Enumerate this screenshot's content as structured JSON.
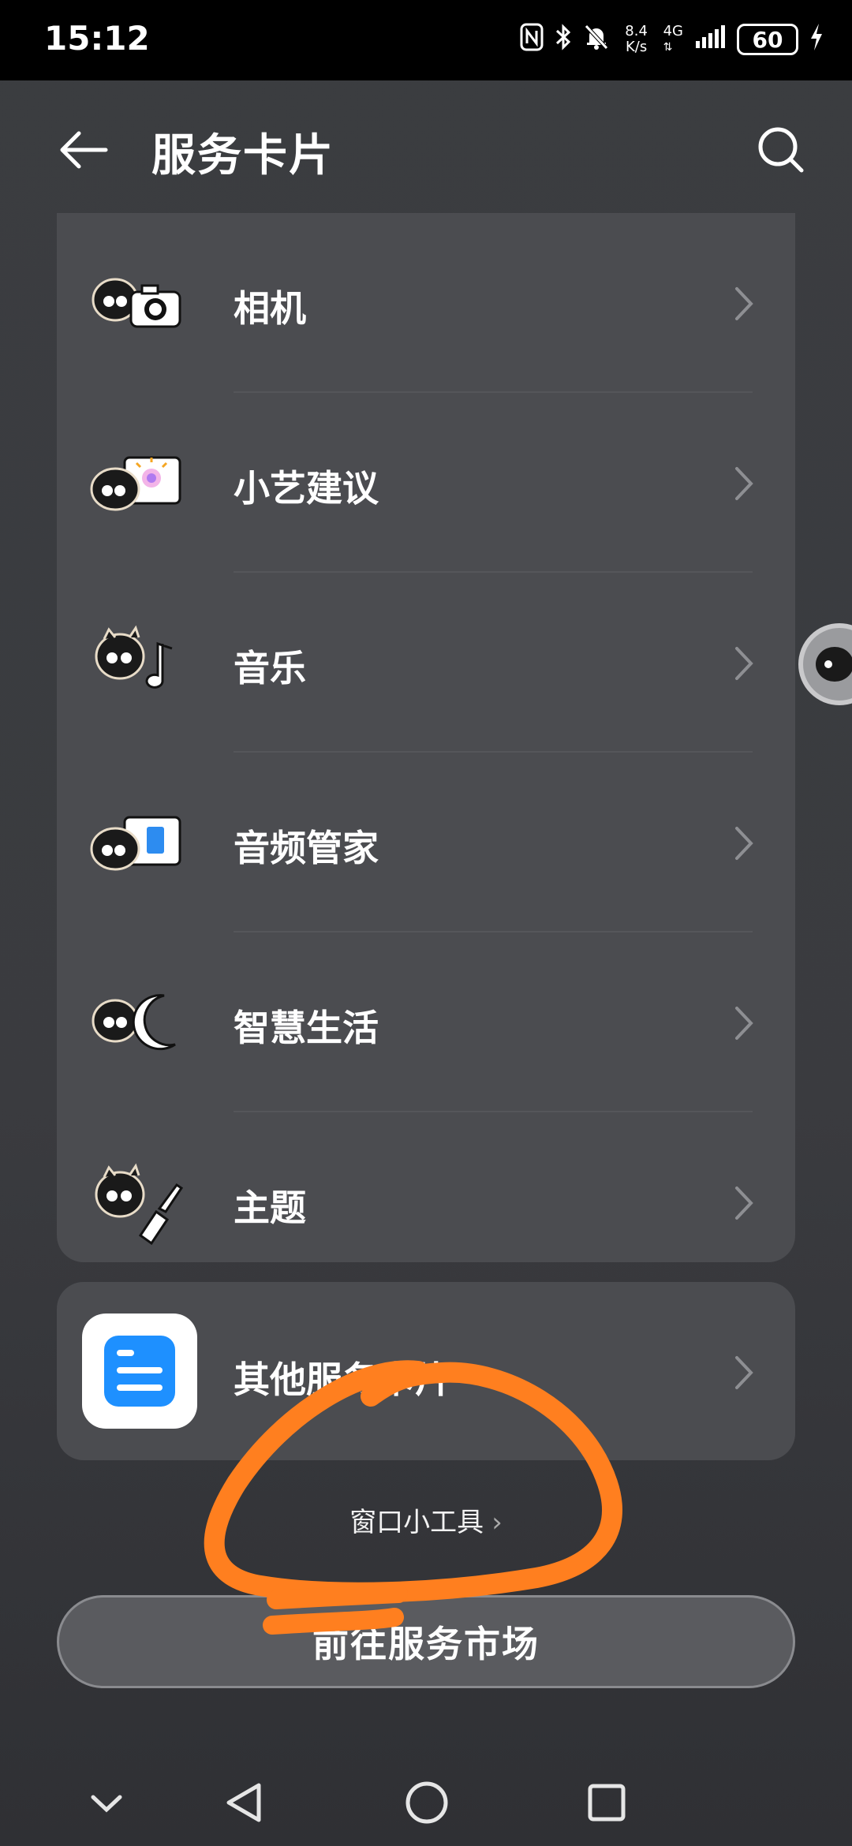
{
  "status_bar": {
    "time": "15:12",
    "speed": "8.4",
    "speed_unit": "K/s",
    "network": "4G",
    "battery": "60"
  },
  "app_bar": {
    "title": "服务卡片"
  },
  "items": [
    {
      "label": "相机",
      "icon": "camera-icon"
    },
    {
      "label": "小艺建议",
      "icon": "xiaoyi-suggestion-icon"
    },
    {
      "label": "音乐",
      "icon": "music-icon"
    },
    {
      "label": "音频管家",
      "icon": "audio-manager-icon"
    },
    {
      "label": "智慧生活",
      "icon": "smart-life-icon"
    },
    {
      "label": "主题",
      "icon": "theme-icon"
    }
  ],
  "other_cards": {
    "label": "其他服务卡片",
    "icon": "document-app-icon"
  },
  "widget_link": {
    "label": "窗口小工具",
    "arrow": "›"
  },
  "primary_button": {
    "label": "前往服务市场"
  },
  "colors": {
    "background": "#3a3b3f",
    "card": "#4b4c50",
    "annotation": "#ff7f1f",
    "accent_blue": "#1e90ff"
  }
}
